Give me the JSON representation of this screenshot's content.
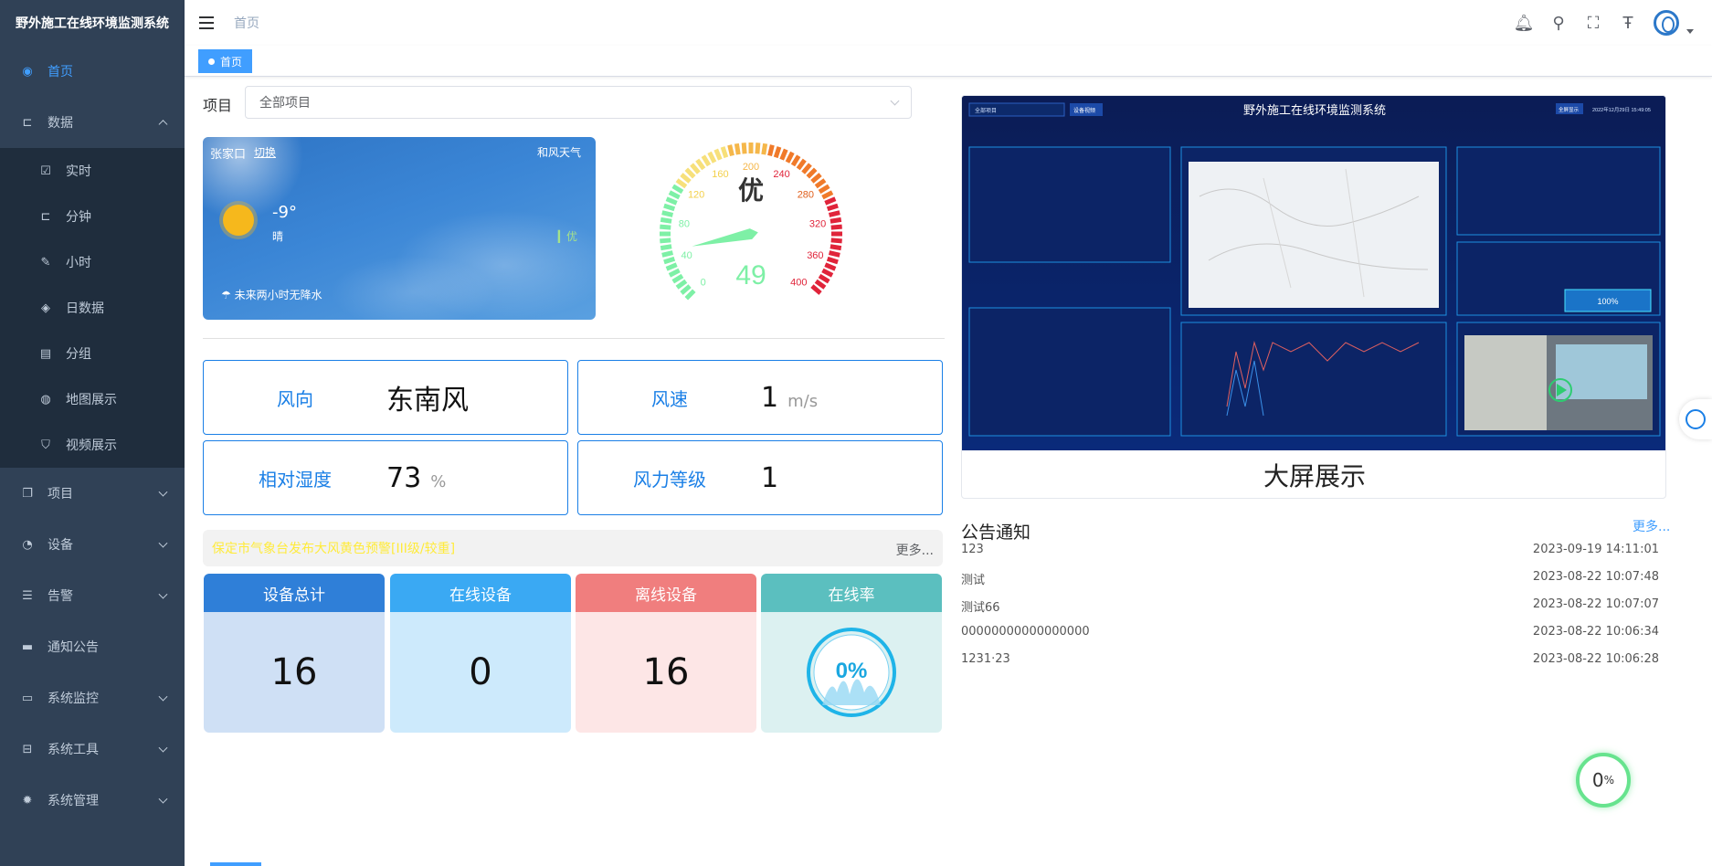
{
  "app": {
    "title": "野外施工在线环境监测系统"
  },
  "sidebar": {
    "items": [
      {
        "label": "首页",
        "icon": "dashboard-icon",
        "active": true
      },
      {
        "label": "数据",
        "icon": "data-icon",
        "expanded": true,
        "children": [
          {
            "label": "实时",
            "icon": "realtime-icon"
          },
          {
            "label": "分钟",
            "icon": "minute-icon"
          },
          {
            "label": "小时",
            "icon": "hour-icon"
          },
          {
            "label": "日数据",
            "icon": "daily-icon"
          },
          {
            "label": "分组",
            "icon": "group-icon"
          },
          {
            "label": "地图展示",
            "icon": "map-icon"
          },
          {
            "label": "视频展示",
            "icon": "video-icon"
          }
        ]
      },
      {
        "label": "项目",
        "icon": "project-icon"
      },
      {
        "label": "设备",
        "icon": "device-icon"
      },
      {
        "label": "告警",
        "icon": "alarm-icon"
      },
      {
        "label": "通知公告",
        "icon": "notice-icon"
      },
      {
        "label": "系统监控",
        "icon": "monitor-icon"
      },
      {
        "label": "系统工具",
        "icon": "tool-icon"
      },
      {
        "label": "系统管理",
        "icon": "system-icon"
      }
    ]
  },
  "header": {
    "breadcrumb": "首页"
  },
  "tags": [
    {
      "label": "首页"
    }
  ],
  "project": {
    "label": "项目",
    "value": "全部项目"
  },
  "weather": {
    "city": "张家口",
    "switch": "切换",
    "brand": "和风天气",
    "temp": "-9°",
    "desc": "晴",
    "aqi": "优",
    "forecast": "未来两小时无降水"
  },
  "gauge": {
    "value": 49,
    "grade": "优",
    "min": 0,
    "max": 400,
    "ticks": [
      "0",
      "40",
      "80",
      "120",
      "160",
      "200",
      "240",
      "280",
      "320",
      "360",
      "400"
    ]
  },
  "metrics": {
    "wind_dir": {
      "label": "风向",
      "value": "东南风"
    },
    "wind_speed": {
      "label": "风速",
      "value": "1",
      "unit": "m/s"
    },
    "humidity": {
      "label": "相对湿度",
      "value": "73",
      "unit": "%"
    },
    "wind_level": {
      "label": "风力等级",
      "value": "1"
    }
  },
  "alert": {
    "text": "保定市气象台发布大风黄色预警[III级/较重]",
    "more": "更多..."
  },
  "stats": [
    {
      "label": "设备总计",
      "value": "16",
      "head": "#2f7fd8",
      "body": "#cfe0f5"
    },
    {
      "label": "在线设备",
      "value": "0",
      "head": "#3aa9f3",
      "body": "#cdeafc"
    },
    {
      "label": "离线设备",
      "value": "16",
      "head": "#f07e7e",
      "body": "#fde6e6"
    },
    {
      "label": "在线率",
      "value": "0%",
      "head": "#5bbfbf",
      "body": "#dcf1f1",
      "rate": 0
    }
  ],
  "bigscreen": {
    "title": "大屏展示",
    "preview_title": "野外施工在线环境监测系统",
    "preview_select": "全部项目",
    "preview_btn": "设备视频",
    "preview_btn2": "全屏显示",
    "preview_time": "2022年12月29日 15:49:05",
    "rate_text": "100%"
  },
  "notices": {
    "title": "公告通知",
    "more": "更多...",
    "items": [
      {
        "title": "123",
        "date": "2023-09-19 14:11:01"
      },
      {
        "title": "测试",
        "date": "2023-08-22 10:07:48"
      },
      {
        "title": "测试66",
        "date": "2023-08-22 10:07:07"
      },
      {
        "title": "00000000000000000",
        "date": "2023-08-22 10:06:34"
      },
      {
        "title": "1231·23",
        "date": "2023-08-22 10:06:28"
      }
    ]
  },
  "progress": {
    "value": "0",
    "unit": "%"
  }
}
